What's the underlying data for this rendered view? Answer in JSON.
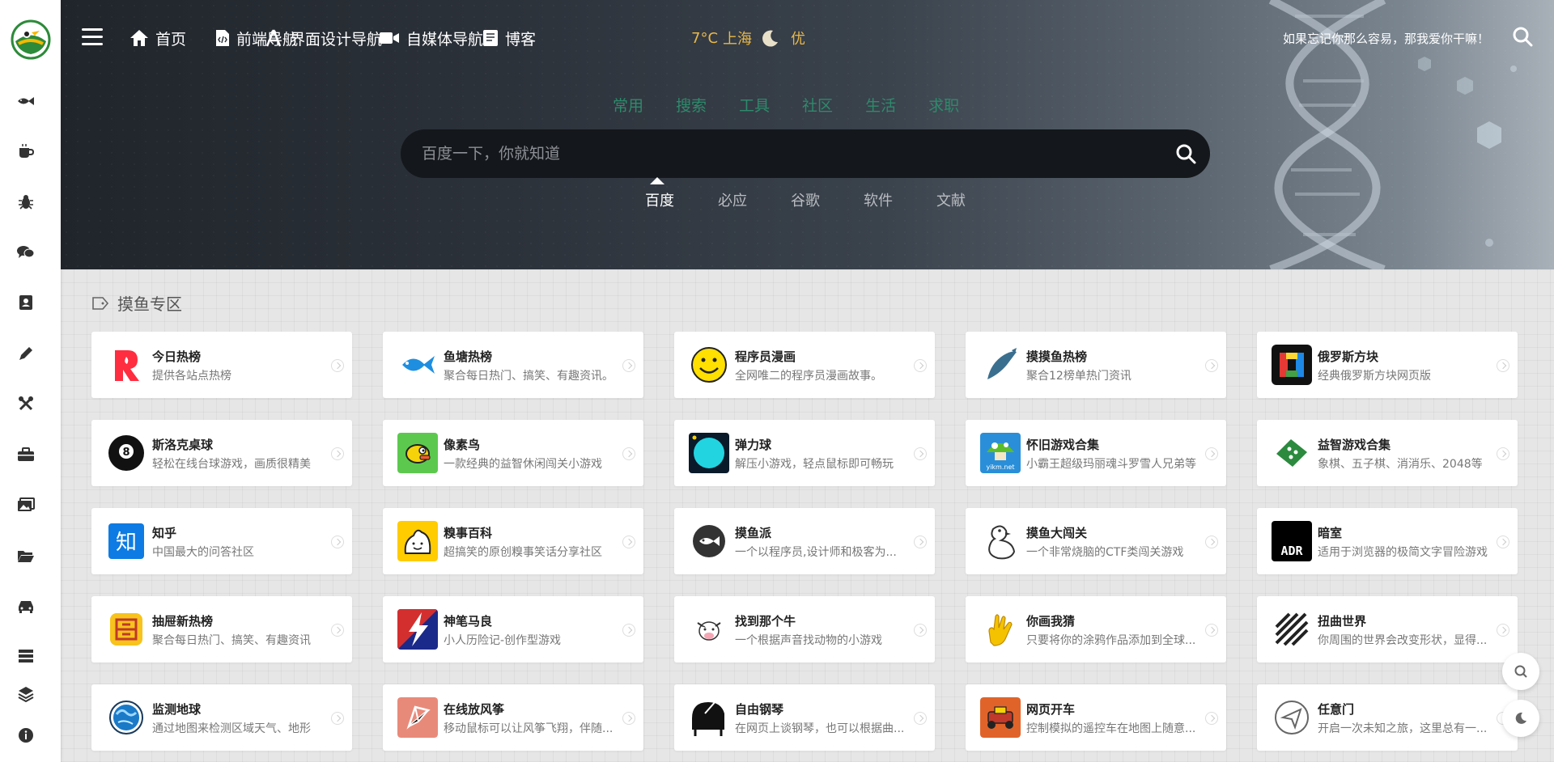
{
  "nav": {
    "items": [
      {
        "label": "首页",
        "icon": "home-icon"
      },
      {
        "label": "前端导航",
        "icon": "code-file-icon"
      },
      {
        "label": "界面设计导航",
        "icon": "design-tools-icon"
      },
      {
        "label": "自媒体导航",
        "icon": "video-camera-icon"
      },
      {
        "label": "博客",
        "icon": "book-icon"
      }
    ],
    "weather": {
      "temp": "7°C",
      "city": "上海",
      "aqi": "优"
    },
    "slogan": "如果忘记你那么容易，那我爱你干嘛！"
  },
  "search": {
    "tabs": [
      "常用",
      "搜索",
      "工具",
      "社区",
      "生活",
      "求职"
    ],
    "placeholder": "百度一下，你就知道",
    "engines": [
      "百度",
      "必应",
      "谷歌",
      "软件",
      "文献"
    ],
    "active_engine": "百度"
  },
  "sidebar": {
    "icons": [
      "fish-icon",
      "coffee-icon",
      "bug-icon",
      "chat-icon",
      "contacts-book-icon",
      "pencil-icon",
      "tools-icon",
      "briefcase-icon",
      "images-icon",
      "folder-open-icon",
      "car-icon",
      "server-icon",
      "layers-icon",
      "info-icon"
    ]
  },
  "section": {
    "title": "摸鱼专区"
  },
  "cards": [
    {
      "title": "今日热榜",
      "desc": "提供各站点热榜",
      "icon": "fire-r-logo",
      "color": "#ff2d3f"
    },
    {
      "title": "鱼塘热榜",
      "desc": "聚合每日热门、搞笑、有趣资讯。",
      "icon": "blue-fish-logo",
      "color": "#1e8fe0"
    },
    {
      "title": "程序员漫画",
      "desc": "全网唯二的程序员漫画故事。",
      "icon": "smiley-logo",
      "color": "#ffe000"
    },
    {
      "title": "摸摸鱼热榜",
      "desc": "聚合12榜单热门资讯",
      "icon": "fish-silhouette-logo",
      "color": "#3a6f8f"
    },
    {
      "title": "俄罗斯方块",
      "desc": "经典俄罗斯方块网页版",
      "icon": "tetris-logo",
      "color": "#111111"
    },
    {
      "title": "斯洛克桌球",
      "desc": "轻松在线台球游戏，画质很精美",
      "icon": "eight-ball-logo",
      "color": "#111111"
    },
    {
      "title": "像素鸟",
      "desc": "一款经典的益智休闲闯关小游戏",
      "icon": "flappy-bird-logo",
      "color": "#5cc94e"
    },
    {
      "title": "弹力球",
      "desc": "解压小游戏，轻点鼠标即可畅玩",
      "icon": "bounce-ball-logo",
      "color": "#22d4e0"
    },
    {
      "title": "怀旧游戏合集",
      "desc": "小霸王超级玛丽魂斗罗雪人兄弟等",
      "icon": "mushroom-logo",
      "color": "#2a8fd8"
    },
    {
      "title": "益智游戏合集",
      "desc": "象棋、五子棋、消消乐、2048等",
      "icon": "board-game-logo",
      "color": "#2b8a3e"
    },
    {
      "title": "知乎",
      "desc": "中国最大的问答社区",
      "icon": "zhihu-logo",
      "color": "#0d7be3"
    },
    {
      "title": "糗事百科",
      "desc": "超搞笑的原创糗事笑话分享社区",
      "icon": "qiushi-logo",
      "color": "#ffcc00"
    },
    {
      "title": "摸鱼派",
      "desc": "一个以程序员,设计师和极客为...",
      "icon": "fish-pie-logo",
      "color": "#333333"
    },
    {
      "title": "摸鱼大闯关",
      "desc": "一个非常烧脑的CTF类闯关游戏",
      "icon": "duck-logo",
      "color": "#333333"
    },
    {
      "title": "暗室",
      "desc": "适用于浏览器的极简文字冒险游戏",
      "icon": "adr-logo",
      "color": "#000000"
    },
    {
      "title": "抽屉新热榜",
      "desc": "聚合每日热门、搞笑、有趣资讯",
      "icon": "drawer-logo",
      "color": "#f7c31c"
    },
    {
      "title": "神笔马良",
      "desc": "小人历险记-创作型游戏",
      "icon": "lightning-logo",
      "color": "#1a2a8a"
    },
    {
      "title": "找到那个牛",
      "desc": "一个根据声音找动物的小游戏",
      "icon": "cow-logo",
      "color": "#ffffff"
    },
    {
      "title": "你画我猜",
      "desc": "只要将你的涂鸦作品添加到全球...",
      "icon": "hand-logo",
      "color": "#f5c200"
    },
    {
      "title": "扭曲世界",
      "desc": "你周围的世界会改变形状，显得...",
      "icon": "twisted-logo",
      "color": "#222222"
    },
    {
      "title": "监测地球",
      "desc": "通过地图来检测区域天气、地形",
      "icon": "earth-logo",
      "color": "#1a7ac8"
    },
    {
      "title": "在线放风筝",
      "desc": "移动鼠标可以让风筝飞翔，伴随...",
      "icon": "kite-logo",
      "color": "#e88a7a"
    },
    {
      "title": "自由钢琴",
      "desc": "在网页上谈钢琴，也可以根据曲...",
      "icon": "piano-logo",
      "color": "#111111"
    },
    {
      "title": "网页开车",
      "desc": "控制模拟的遥控车在地图上随意...",
      "icon": "rc-car-logo",
      "color": "#e0642a"
    },
    {
      "title": "任意门",
      "desc": "开启一次未知之旅，这里总有一...",
      "icon": "paper-plane-logo",
      "color": "#666666"
    }
  ],
  "floating": [
    "search-icon",
    "theme-toggle-icon"
  ]
}
